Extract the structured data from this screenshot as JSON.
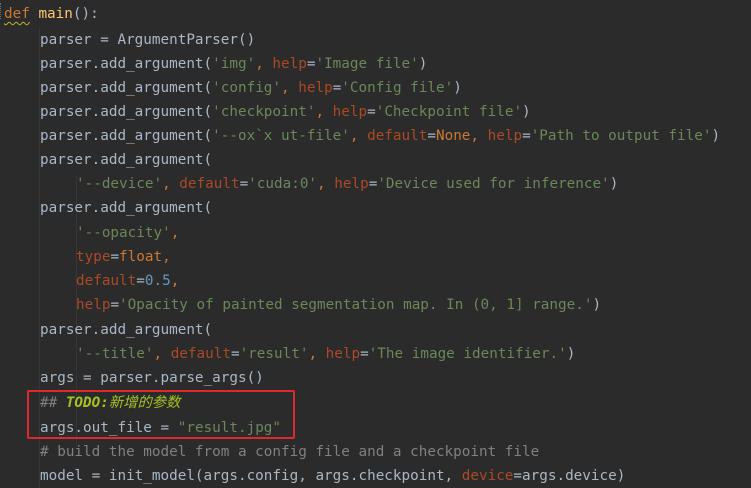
{
  "editor": {
    "lines": [
      {
        "tokens": [
          {
            "t": "def",
            "c": "kw squiggle"
          },
          {
            "t": " ",
            "c": "plain"
          },
          {
            "t": "main",
            "c": "fn"
          },
          {
            "t": "():",
            "c": "plain"
          }
        ]
      },
      {
        "tokens": [
          {
            "t": "parser = ArgumentParser()",
            "c": "plain"
          }
        ]
      },
      {
        "tokens": [
          {
            "t": "parser.add_argument(",
            "c": "plain"
          },
          {
            "t": "'img'",
            "c": "str"
          },
          {
            "t": ", ",
            "c": "kw"
          },
          {
            "t": "help",
            "c": "param"
          },
          {
            "t": "=",
            "c": "plain"
          },
          {
            "t": "'Image file'",
            "c": "str"
          },
          {
            "t": ")",
            "c": "plain"
          }
        ]
      },
      {
        "tokens": [
          {
            "t": "parser.add_argument(",
            "c": "plain"
          },
          {
            "t": "'config'",
            "c": "str"
          },
          {
            "t": ", ",
            "c": "kw"
          },
          {
            "t": "help",
            "c": "param"
          },
          {
            "t": "=",
            "c": "plain"
          },
          {
            "t": "'Config file'",
            "c": "str"
          },
          {
            "t": ")",
            "c": "plain"
          }
        ]
      },
      {
        "tokens": [
          {
            "t": "parser.add_argument(",
            "c": "plain"
          },
          {
            "t": "'checkpoint'",
            "c": "str"
          },
          {
            "t": ", ",
            "c": "kw"
          },
          {
            "t": "help",
            "c": "param"
          },
          {
            "t": "=",
            "c": "plain"
          },
          {
            "t": "'Checkpoint file'",
            "c": "str"
          },
          {
            "t": ")",
            "c": "plain"
          }
        ]
      },
      {
        "tokens": [
          {
            "t": "parser.add_argument(",
            "c": "plain"
          },
          {
            "t": "'--ox`x ut-file'",
            "c": "str"
          },
          {
            "t": ", ",
            "c": "kw"
          },
          {
            "t": "default",
            "c": "param"
          },
          {
            "t": "=",
            "c": "plain"
          },
          {
            "t": "None",
            "c": "kw"
          },
          {
            "t": ", ",
            "c": "kw"
          },
          {
            "t": "help",
            "c": "param"
          },
          {
            "t": "=",
            "c": "plain"
          },
          {
            "t": "'Path to output file'",
            "c": "str"
          },
          {
            "t": ")",
            "c": "plain"
          }
        ]
      },
      {
        "tokens": [
          {
            "t": "parser.add_argument(",
            "c": "plain"
          }
        ]
      },
      {
        "tokens": [
          {
            "t": "'--device'",
            "c": "str"
          },
          {
            "t": ", ",
            "c": "kw"
          },
          {
            "t": "default",
            "c": "param"
          },
          {
            "t": "=",
            "c": "plain"
          },
          {
            "t": "'cuda:0'",
            "c": "str"
          },
          {
            "t": ", ",
            "c": "kw"
          },
          {
            "t": "help",
            "c": "param"
          },
          {
            "t": "=",
            "c": "plain"
          },
          {
            "t": "'Device used for inference'",
            "c": "str"
          },
          {
            "t": ")",
            "c": "plain"
          }
        ]
      },
      {
        "tokens": [
          {
            "t": "parser.add_argument(",
            "c": "plain"
          }
        ]
      },
      {
        "tokens": [
          {
            "t": "'--opacity'",
            "c": "str"
          },
          {
            "t": ",",
            "c": "kw"
          }
        ]
      },
      {
        "tokens": [
          {
            "t": "type",
            "c": "param"
          },
          {
            "t": "=",
            "c": "plain"
          },
          {
            "t": "float",
            "c": "kw"
          },
          {
            "t": ",",
            "c": "kw"
          }
        ]
      },
      {
        "tokens": [
          {
            "t": "default",
            "c": "param"
          },
          {
            "t": "=",
            "c": "plain"
          },
          {
            "t": "0.5",
            "c": "num"
          },
          {
            "t": ",",
            "c": "kw"
          }
        ]
      },
      {
        "tokens": [
          {
            "t": "help",
            "c": "param"
          },
          {
            "t": "=",
            "c": "plain"
          },
          {
            "t": "'Opacity of painted segmentation map. In (0, 1] range.'",
            "c": "str"
          },
          {
            "t": ")",
            "c": "plain"
          }
        ]
      },
      {
        "tokens": [
          {
            "t": "parser.add_argument(",
            "c": "plain"
          }
        ]
      },
      {
        "tokens": [
          {
            "t": "'--title'",
            "c": "str"
          },
          {
            "t": ", ",
            "c": "kw"
          },
          {
            "t": "default",
            "c": "param"
          },
          {
            "t": "=",
            "c": "plain"
          },
          {
            "t": "'result'",
            "c": "str"
          },
          {
            "t": ", ",
            "c": "kw"
          },
          {
            "t": "help",
            "c": "param"
          },
          {
            "t": "=",
            "c": "plain"
          },
          {
            "t": "'The image identifier.'",
            "c": "str"
          },
          {
            "t": ")",
            "c": "plain"
          }
        ]
      },
      {
        "tokens": [
          {
            "t": "args = parser.parse_args()",
            "c": "plain"
          }
        ]
      },
      {
        "tokens": [
          {
            "t": "## ",
            "c": "comment"
          },
          {
            "t": "TODO:",
            "c": "todo"
          },
          {
            "t": "新增的参数",
            "c": "todo-cn"
          }
        ]
      },
      {
        "tokens": [
          {
            "t": "args.out_file = ",
            "c": "plain"
          },
          {
            "t": "\"result.jpg\"",
            "c": "str"
          }
        ]
      },
      {
        "tokens": [
          {
            "t": "# build the model from a config file and a checkpoint file",
            "c": "comment"
          }
        ]
      },
      {
        "tokens": [
          {
            "t": "model = init_model(args.config, args.checkpoint, ",
            "c": "plain"
          },
          {
            "t": "device",
            "c": "param"
          },
          {
            "t": "=",
            "c": "plain"
          },
          {
            "t": "args.device)",
            "c": "plain"
          }
        ]
      }
    ]
  },
  "colors": {
    "background": "#2b2b2b",
    "keyword": "#cc7832",
    "function": "#ffc66d",
    "string": "#6a8759",
    "number": "#6897bb",
    "parameter": "#aa4926",
    "comment": "#808080",
    "todo": "#a8c023",
    "highlight_box": "#e0282b"
  }
}
